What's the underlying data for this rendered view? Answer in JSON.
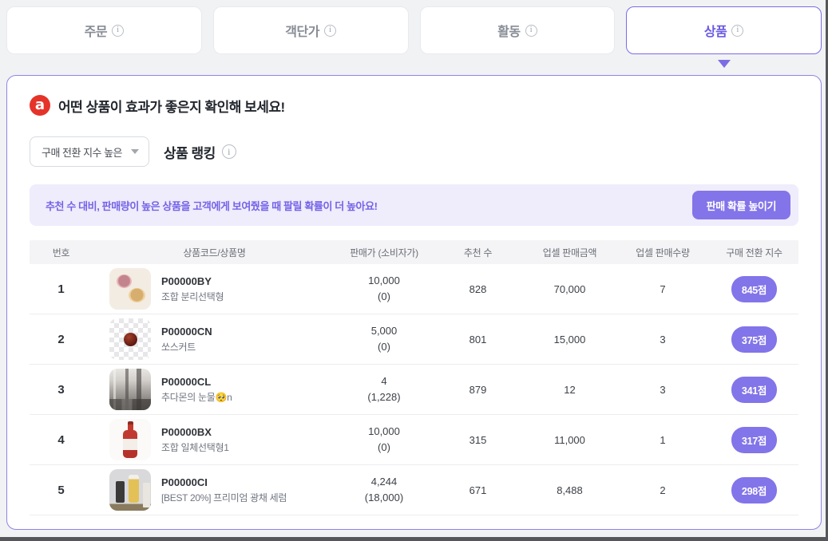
{
  "colors": {
    "accent_purple": "#7b6ce4",
    "badge_purple": "#8274e9",
    "banner_bg": "#efecfb",
    "banner_text_purple": "#7463e8",
    "logo_red": "#e5332a",
    "page_bg": "#f1f2f4",
    "frame_edge": "#56575b"
  },
  "tabs": [
    {
      "id": "tab-order",
      "label": "주문",
      "active": false
    },
    {
      "id": "tab-average-order-value",
      "label": "객단가",
      "active": false
    },
    {
      "id": "tab-activity",
      "label": "활동",
      "active": false
    },
    {
      "id": "tab-product",
      "label": "상품",
      "active": true
    }
  ],
  "panel": {
    "title": "어떤 상품이 효과가 좋은지 확인해 보세요!",
    "sort_dropdown": {
      "value": "구매 전환 지수 높은"
    },
    "section_title": "상품 랭킹",
    "banner": {
      "text": "추천 수 대비, 판매량이 높은 상품을 고객에게 보여줬을 때 팔릴 확률이 더 높아요!",
      "button_label": "판매 확률 높이기"
    },
    "table": {
      "headers": [
        "번호",
        "상품코드/상품명",
        "판매가 (소비자가)",
        "추천 수",
        "업셀 판매금액",
        "업셀 판매수량",
        "구매 전환 지수"
      ],
      "rows": [
        {
          "no": "1",
          "thumb": "two-bowls",
          "code": "P00000BY",
          "name": "조합 분리선택형",
          "price": "10,000",
          "consumer_price": "(0)",
          "recommend_count": "828",
          "upsell_amount": "70,000",
          "upsell_qty": "7",
          "score": "845점"
        },
        {
          "no": "2",
          "thumb": "checker-sauce",
          "code": "P00000CN",
          "name": "쏘스커트",
          "price": "5,000",
          "consumer_price": "(0)",
          "recommend_count": "801",
          "upsell_amount": "15,000",
          "upsell_qty": "3",
          "score": "375점"
        },
        {
          "no": "3",
          "thumb": "store-interior",
          "code": "P00000CL",
          "name": "추다몬의 눈물🥺n",
          "price": "4",
          "consumer_price": "(1,228)",
          "recommend_count": "879",
          "upsell_amount": "12",
          "upsell_qty": "3",
          "score": "341점"
        },
        {
          "no": "4",
          "thumb": "ketchup-bottle",
          "code": "P00000BX",
          "name": "조합 일체선택형1",
          "price": "10,000",
          "consumer_price": "(0)",
          "recommend_count": "315",
          "upsell_amount": "11,000",
          "upsell_qty": "1",
          "score": "317점"
        },
        {
          "no": "5",
          "thumb": "serum-bottles",
          "code": "P00000CI",
          "name": "[BEST 20%] 프리미엄 광채 세럼",
          "price": "4,244",
          "consumer_price": "(18,000)",
          "recommend_count": "671",
          "upsell_amount": "8,488",
          "upsell_qty": "2",
          "score": "298점"
        }
      ]
    }
  }
}
